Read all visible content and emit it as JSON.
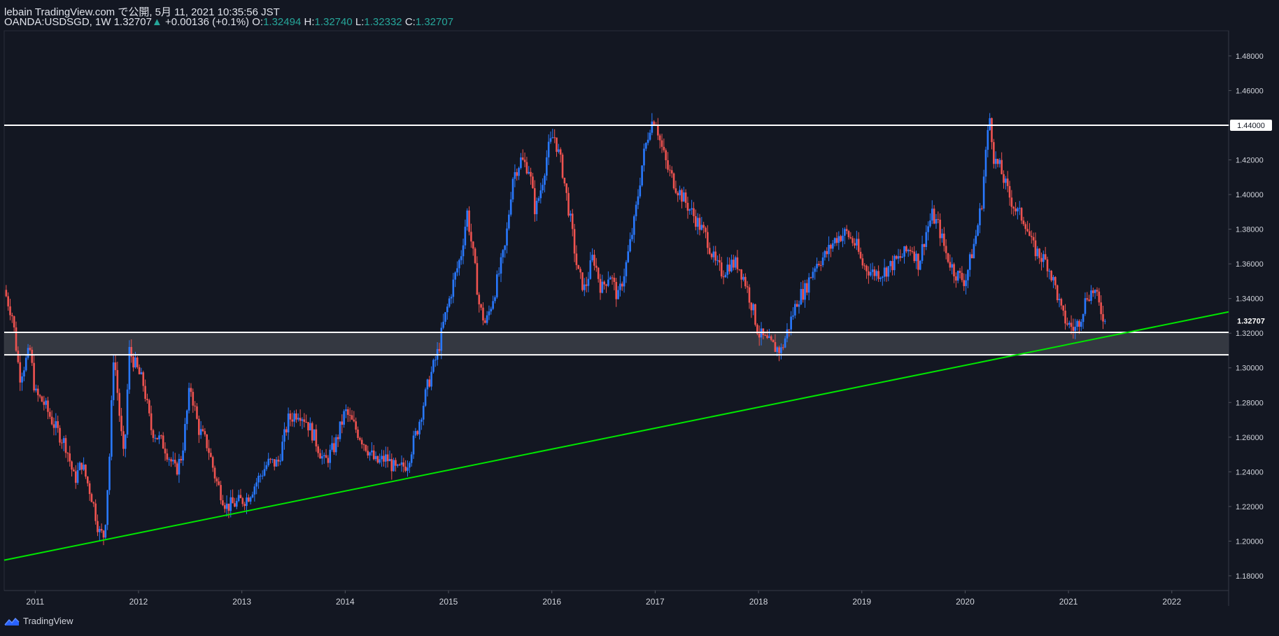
{
  "header": {
    "publish_line": "lebain TradingView.com で公開, 5月 11, 2021 10:35:56 JST",
    "symbol": "OANDA:USDSGD, 1W",
    "last": "1.32707",
    "up_arrow": "▲",
    "change": "+0.00136 (+0.1%)",
    "o_label": "O:",
    "o_value": "1.32494",
    "h_label": "H:",
    "h_value": "1.32740",
    "l_label": "L:",
    "l_value": "1.32332",
    "c_label": "C:",
    "c_value": "1.32707"
  },
  "footer": {
    "brand": "TradingView",
    "logo_icon": "tradingview-logo-icon"
  },
  "colors": {
    "background": "#131722",
    "up": "#2979ff",
    "down": "#ef5350",
    "trendline": "#00e600",
    "level": "#ffffff",
    "zone": "#3b3e47",
    "axis_text": "#d1d4dc"
  },
  "chart_data": {
    "type": "candlestick",
    "symbol": "OANDA:USDSGD",
    "interval": "1W",
    "x_ticks": [
      "2011",
      "2012",
      "2013",
      "2014",
      "2015",
      "2016",
      "2017",
      "2018",
      "2019",
      "2020",
      "2021",
      "2022"
    ],
    "y_ticks": [
      "1.18000",
      "1.20000",
      "1.22000",
      "1.24000",
      "1.26000",
      "1.28000",
      "1.30000",
      "1.32000",
      "1.34000",
      "1.36000",
      "1.38000",
      "1.40000",
      "1.42000",
      "1.44000",
      "1.46000",
      "1.48000"
    ],
    "ylim": [
      1.1715,
      1.4945
    ],
    "xlim": [
      2010.7,
      2022.55
    ],
    "close_path": [
      [
        2010.7,
        1.345
      ],
      [
        2010.78,
        1.33
      ],
      [
        2010.85,
        1.295
      ],
      [
        2010.95,
        1.31
      ],
      [
        2011.0,
        1.285
      ],
      [
        2011.08,
        1.28
      ],
      [
        2011.2,
        1.265
      ],
      [
        2011.3,
        1.255
      ],
      [
        2011.38,
        1.235
      ],
      [
        2011.45,
        1.245
      ],
      [
        2011.55,
        1.225
      ],
      [
        2011.62,
        1.205
      ],
      [
        2011.67,
        1.203
      ],
      [
        2011.72,
        1.25
      ],
      [
        2011.76,
        1.31
      ],
      [
        2011.82,
        1.27
      ],
      [
        2011.86,
        1.245
      ],
      [
        2011.91,
        1.31
      ],
      [
        2011.98,
        1.3
      ],
      [
        2012.05,
        1.29
      ],
      [
        2012.12,
        1.265
      ],
      [
        2012.25,
        1.255
      ],
      [
        2012.36,
        1.24
      ],
      [
        2012.42,
        1.25
      ],
      [
        2012.5,
        1.29
      ],
      [
        2012.58,
        1.265
      ],
      [
        2012.67,
        1.255
      ],
      [
        2012.75,
        1.235
      ],
      [
        2012.85,
        1.22
      ],
      [
        2012.95,
        1.222
      ],
      [
        2013.05,
        1.225
      ],
      [
        2013.15,
        1.235
      ],
      [
        2013.25,
        1.245
      ],
      [
        2013.35,
        1.245
      ],
      [
        2013.45,
        1.27
      ],
      [
        2013.55,
        1.275
      ],
      [
        2013.62,
        1.27
      ],
      [
        2013.7,
        1.26
      ],
      [
        2013.8,
        1.245
      ],
      [
        2013.9,
        1.255
      ],
      [
        2014.0,
        1.275
      ],
      [
        2014.1,
        1.265
      ],
      [
        2014.2,
        1.255
      ],
      [
        2014.3,
        1.245
      ],
      [
        2014.4,
        1.248
      ],
      [
        2014.5,
        1.24
      ],
      [
        2014.6,
        1.245
      ],
      [
        2014.7,
        1.265
      ],
      [
        2014.8,
        1.29
      ],
      [
        2014.9,
        1.31
      ],
      [
        2014.95,
        1.325
      ],
      [
        2015.05,
        1.35
      ],
      [
        2015.12,
        1.365
      ],
      [
        2015.18,
        1.39
      ],
      [
        2015.25,
        1.36
      ],
      [
        2015.3,
        1.335
      ],
      [
        2015.36,
        1.325
      ],
      [
        2015.45,
        1.345
      ],
      [
        2015.55,
        1.37
      ],
      [
        2015.62,
        1.41
      ],
      [
        2015.7,
        1.42
      ],
      [
        2015.78,
        1.415
      ],
      [
        2015.84,
        1.39
      ],
      [
        2015.9,
        1.405
      ],
      [
        2015.96,
        1.425
      ],
      [
        2016.02,
        1.435
      ],
      [
        2016.1,
        1.415
      ],
      [
        2016.18,
        1.385
      ],
      [
        2016.25,
        1.355
      ],
      [
        2016.32,
        1.345
      ],
      [
        2016.4,
        1.365
      ],
      [
        2016.48,
        1.345
      ],
      [
        2016.56,
        1.355
      ],
      [
        2016.64,
        1.34
      ],
      [
        2016.72,
        1.36
      ],
      [
        2016.8,
        1.385
      ],
      [
        2016.88,
        1.42
      ],
      [
        2016.95,
        1.44
      ],
      [
        2017.0,
        1.445
      ],
      [
        2017.05,
        1.43
      ],
      [
        2017.12,
        1.415
      ],
      [
        2017.2,
        1.405
      ],
      [
        2017.3,
        1.395
      ],
      [
        2017.4,
        1.385
      ],
      [
        2017.5,
        1.375
      ],
      [
        2017.58,
        1.36
      ],
      [
        2017.65,
        1.355
      ],
      [
        2017.72,
        1.36
      ],
      [
        2017.8,
        1.36
      ],
      [
        2017.87,
        1.35
      ],
      [
        2017.94,
        1.335
      ],
      [
        2018.0,
        1.32
      ],
      [
        2018.08,
        1.315
      ],
      [
        2018.15,
        1.312
      ],
      [
        2018.22,
        1.31
      ],
      [
        2018.3,
        1.325
      ],
      [
        2018.38,
        1.34
      ],
      [
        2018.45,
        1.345
      ],
      [
        2018.55,
        1.36
      ],
      [
        2018.65,
        1.365
      ],
      [
        2018.75,
        1.375
      ],
      [
        2018.85,
        1.378
      ],
      [
        2018.95,
        1.37
      ],
      [
        2019.0,
        1.36
      ],
      [
        2019.1,
        1.355
      ],
      [
        2019.2,
        1.355
      ],
      [
        2019.3,
        1.36
      ],
      [
        2019.4,
        1.365
      ],
      [
        2019.48,
        1.37
      ],
      [
        2019.55,
        1.36
      ],
      [
        2019.62,
        1.378
      ],
      [
        2019.68,
        1.388
      ],
      [
        2019.74,
        1.382
      ],
      [
        2019.82,
        1.365
      ],
      [
        2019.9,
        1.355
      ],
      [
        2020.0,
        1.35
      ],
      [
        2020.1,
        1.375
      ],
      [
        2020.16,
        1.395
      ],
      [
        2020.2,
        1.425
      ],
      [
        2020.24,
        1.445
      ],
      [
        2020.28,
        1.42
      ],
      [
        2020.34,
        1.415
      ],
      [
        2020.42,
        1.4
      ],
      [
        2020.5,
        1.39
      ],
      [
        2020.58,
        1.385
      ],
      [
        2020.65,
        1.37
      ],
      [
        2020.72,
        1.365
      ],
      [
        2020.8,
        1.36
      ],
      [
        2020.88,
        1.345
      ],
      [
        2020.94,
        1.33
      ],
      [
        2021.0,
        1.325
      ],
      [
        2021.06,
        1.322
      ],
      [
        2021.12,
        1.33
      ],
      [
        2021.18,
        1.342
      ],
      [
        2021.25,
        1.345
      ],
      [
        2021.3,
        1.335
      ],
      [
        2021.36,
        1.327
      ]
    ],
    "last_close": 1.32707,
    "horizontal_levels": [
      1.44,
      1.3205,
      1.3075
    ],
    "zone": [
      1.3075,
      1.3205
    ],
    "trendline": [
      [
        2010.7,
        1.189
      ],
      [
        2022.55,
        1.3323
      ]
    ],
    "labels": {
      "resistance": "1.44000",
      "last": "1.32707"
    }
  }
}
